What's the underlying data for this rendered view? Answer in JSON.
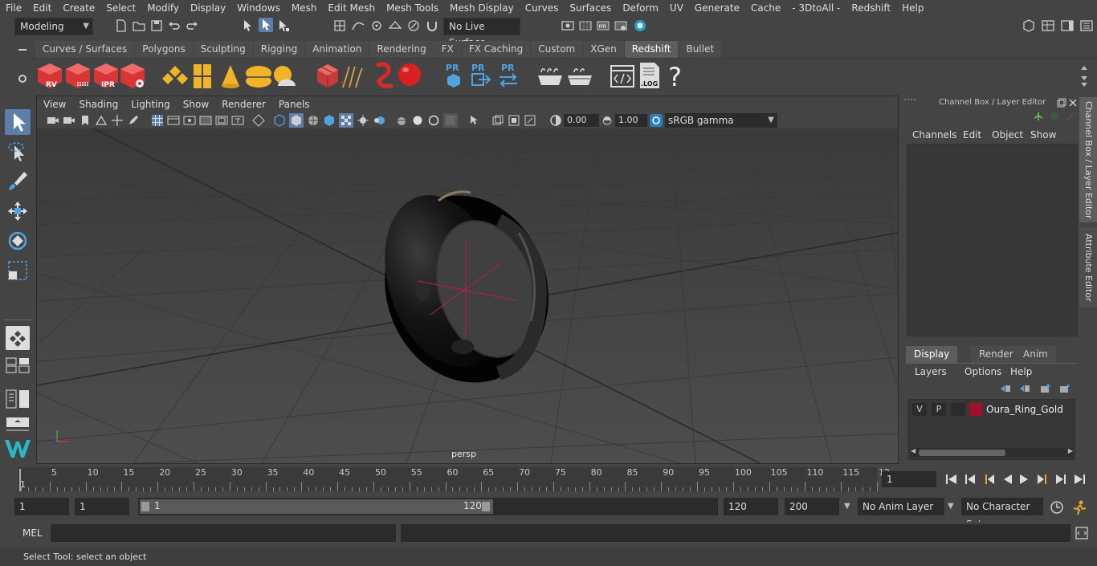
{
  "menubar": {
    "items": [
      "File",
      "Edit",
      "Create",
      "Select",
      "Modify",
      "Display",
      "Windows",
      "Mesh",
      "Edit Mesh",
      "Mesh Tools",
      "Mesh Display",
      "Curves",
      "Surfaces",
      "Deform",
      "UV",
      "Generate",
      "Cache",
      "- 3DtoAll -",
      "Redshift",
      "Help"
    ]
  },
  "statusline": {
    "workspace": "Modeling",
    "live_surface": "No Live Surface"
  },
  "shelf": {
    "tabs": [
      "Curves / Surfaces",
      "Polygons",
      "Sculpting",
      "Rigging",
      "Animation",
      "Rendering",
      "FX",
      "FX Caching",
      "Custom",
      "XGen",
      "Redshift",
      "Bullet"
    ],
    "active_tab": "Redshift",
    "icon_labels": {
      "rv": "RV",
      "ipr": "IPR",
      "pr1": "PR",
      "pr2": "PR",
      "pr3": "PR",
      "log": ".LOG",
      "help": "?"
    }
  },
  "viewport": {
    "menu": [
      "View",
      "Shading",
      "Lighting",
      "Show",
      "Renderer",
      "Panels"
    ],
    "exposure": "0.00",
    "gamma": "1.00",
    "color_space": "sRGB gamma",
    "camera_label": "persp"
  },
  "channelbox": {
    "title": "Channel Box / Layer Editor",
    "menu": [
      "Channels",
      "Edit",
      "Object",
      "Show"
    ],
    "tabs": [
      "Display",
      "Render",
      "Anim"
    ],
    "active_tab": "Display",
    "layer_menu": [
      "Layers",
      "Options",
      "Help"
    ],
    "layer": {
      "v": "V",
      "p": "P",
      "name": "Oura_Ring_Gold",
      "color": "#a0102a"
    }
  },
  "sidetabs": {
    "tab1": "Channel Box / Layer Editor",
    "tab2": "Attribute Editor"
  },
  "timeline": {
    "ticks": [
      "5",
      "10",
      "15",
      "20",
      "25",
      "30",
      "35",
      "40",
      "45",
      "50",
      "55",
      "60",
      "65",
      "70",
      "75",
      "80",
      "85",
      "90",
      "95",
      "100",
      "105",
      "110",
      "115",
      "12"
    ],
    "start_marker": "1",
    "current_frame": "1"
  },
  "range": {
    "start": "1",
    "playback_start": "1",
    "slider_start": "1",
    "slider_end": "120",
    "playback_end": "120",
    "end": "200",
    "anim_layer": "No Anim Layer",
    "char_set": "No Character Set"
  },
  "cmdline": {
    "lang": "MEL"
  },
  "helpline": {
    "text": "Select Tool: select an object"
  }
}
